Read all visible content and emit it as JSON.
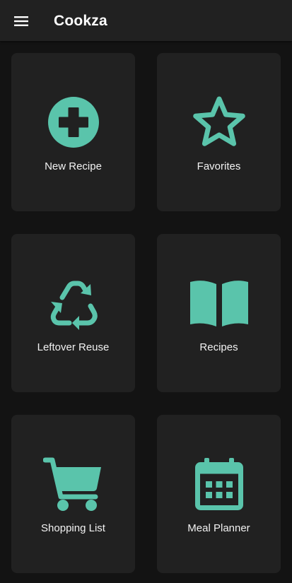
{
  "app": {
    "title": "Cookza",
    "accent_color": "#5ac4ab",
    "background_color": "#131313",
    "surface_color": "#212121"
  },
  "toolbar": {
    "menu_icon": "hamburger-menu-icon"
  },
  "tiles": [
    {
      "label": "New Recipe",
      "icon": "plus-circle-icon"
    },
    {
      "label": "Favorites",
      "icon": "star-outline-icon"
    },
    {
      "label": "Leftover Reuse",
      "icon": "recycle-icon"
    },
    {
      "label": "Recipes",
      "icon": "open-book-icon"
    },
    {
      "label": "Shopping List",
      "icon": "shopping-cart-icon"
    },
    {
      "label": "Meal Planner",
      "icon": "calendar-icon"
    }
  ]
}
